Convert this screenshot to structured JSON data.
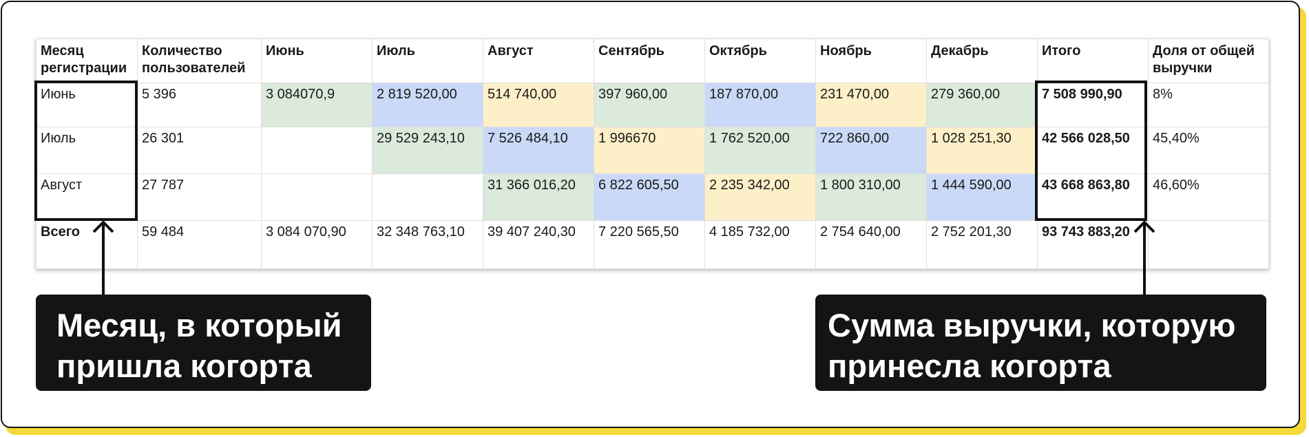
{
  "table": {
    "headers": [
      "Месяц регистрации",
      "Количество пользователей",
      "Июнь",
      "Июль",
      "Август",
      "Сентябрь",
      "Октябрь",
      "Ноябрь",
      "Декабрь",
      "Итого",
      "Доля от общей выручки"
    ],
    "rows": [
      [
        "Июнь",
        "5 396",
        "3 084070,9",
        "2 819 520,00",
        "514 740,00",
        "397 960,00",
        "187 870,00",
        "231 470,00",
        "279 360,00",
        "7 508 990,90",
        "8%"
      ],
      [
        "Июль",
        "26 301",
        "",
        "29 529 243,10",
        "7 526 484,10",
        "1 996670",
        "1 762 520,00",
        "722 860,00",
        "1 028 251,30",
        "42 566 028,50",
        "45,40%"
      ],
      [
        "Август",
        "27 787",
        "",
        "",
        "31 366 016,20",
        "6 822 605,50",
        "2 235 342,00",
        "1 800 310,00",
        "1 444 590,00",
        "43 668 863,80",
        "46,60%"
      ],
      [
        "Всего",
        "59 484",
        "3 084 070,90",
        "32 348 763,10",
        "39 407 240,30",
        "7 220 565,50",
        "4 185 732,00",
        "2 754 640,00",
        "2 752 201,30",
        "93 743 883,20",
        ""
      ]
    ],
    "cell_colors": {
      "green": "#dbeadb",
      "blue": "#c9d9f7",
      "yellow": "#fdf0c8"
    }
  },
  "callouts": {
    "left": {
      "line1": "Месяц, в который",
      "line2": "пришла когорта"
    },
    "right": {
      "line1": "Сумма выручки, которую",
      "line2": "принесла когорта"
    }
  },
  "colors": {
    "accent_shadow": "#f6d93a",
    "frame": "#111111",
    "label_bg": "#141414"
  }
}
